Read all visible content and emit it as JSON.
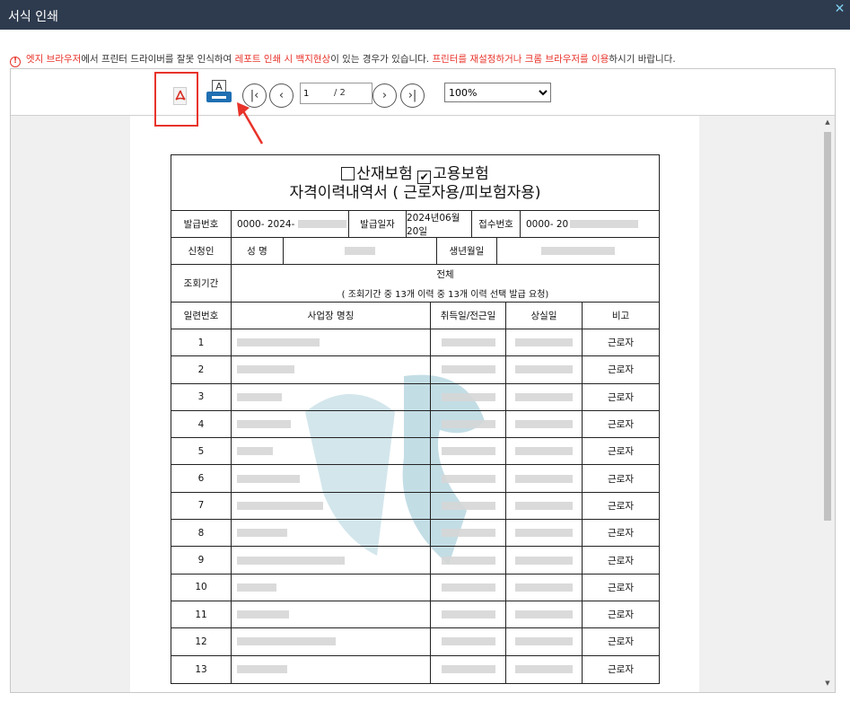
{
  "window": {
    "title": "서식 인쇄",
    "close_icon": "✕"
  },
  "notice": {
    "icon": "!",
    "p1": "엣지 브라우저",
    "p2": "에서 프린터 드라이버를 잘못 인식하여 ",
    "p3": "레포트 인쇄 시 백지현상",
    "p4": "이 있는 경우가 있습니다. ",
    "p5": "프린터를 재설정하거나 크롬 브라우저를 이용",
    "p6": "하시기 바랍니다."
  },
  "toolbar": {
    "print_glyph": "A",
    "first": "|‹",
    "prev": "‹",
    "next": "›",
    "last": "›|",
    "page_value": "1",
    "page_total": "/ 2",
    "zoom_options": [
      "100%"
    ]
  },
  "form": {
    "insurance_industrial": "산재보험",
    "insurance_employment": "고용보험",
    "check_mark": "✔",
    "doc_title": "자격이력내역서 ( 근로자용/피보험자용)",
    "issue_no_label": "발급번호",
    "issue_no_value": "0000- 2024-",
    "issue_date_label": "발급일자",
    "issue_date_value": "2024년06월20일",
    "receipt_no_label": "접수번호",
    "receipt_no_value": "0000- 20",
    "applicant_label": "신청인",
    "name_label": "성 명",
    "birth_label": "생년월일",
    "period_label": "조회기간",
    "period_value": "전체",
    "period_note": "( 조회기간 중 13개 이력 중 13개 이력 선택 발급 요청)",
    "col_seq": "일련번호",
    "col_workplace": "사업장 명칭",
    "col_acquire": "취득일/전근일",
    "col_loss": "상실일",
    "col_note": "비고",
    "rows": [
      {
        "seq": "1",
        "note": "근로자"
      },
      {
        "seq": "2",
        "note": "근로자"
      },
      {
        "seq": "3",
        "note": "근로자"
      },
      {
        "seq": "4",
        "note": "근로자"
      },
      {
        "seq": "5",
        "note": "근로자"
      },
      {
        "seq": "6",
        "note": "근로자"
      },
      {
        "seq": "7",
        "note": "근로자"
      },
      {
        "seq": "8",
        "note": "근로자"
      },
      {
        "seq": "9",
        "note": "근로자"
      },
      {
        "seq": "10",
        "note": "근로자"
      },
      {
        "seq": "11",
        "note": "근로자"
      },
      {
        "seq": "12",
        "note": "근로자"
      },
      {
        "seq": "13",
        "note": "근로자"
      }
    ]
  },
  "colors": {
    "titlebar": "#2e3b4e",
    "highlight": "#e8332a",
    "printer": "#1f6fb2",
    "watermark": "#2f8aa6"
  }
}
